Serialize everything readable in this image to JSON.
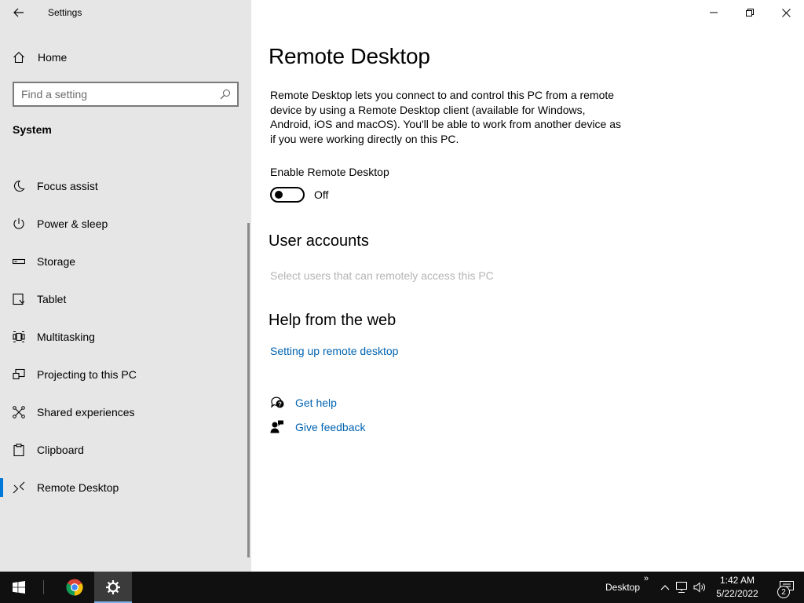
{
  "window": {
    "title": "Settings"
  },
  "sidebar": {
    "home_label": "Home",
    "search_placeholder": "Find a setting",
    "section_title": "System",
    "items": [
      {
        "label": "Focus assist",
        "icon": "moon-icon"
      },
      {
        "label": "Power & sleep",
        "icon": "power-icon"
      },
      {
        "label": "Storage",
        "icon": "storage-icon"
      },
      {
        "label": "Tablet",
        "icon": "tablet-icon"
      },
      {
        "label": "Multitasking",
        "icon": "multitasking-icon"
      },
      {
        "label": "Projecting to this PC",
        "icon": "projecting-icon"
      },
      {
        "label": "Shared experiences",
        "icon": "shared-experiences-icon"
      },
      {
        "label": "Clipboard",
        "icon": "clipboard-icon"
      },
      {
        "label": "Remote Desktop",
        "icon": "remote-desktop-icon",
        "active": true
      }
    ]
  },
  "main": {
    "title": "Remote Desktop",
    "description": "Remote Desktop lets you connect to and control this PC from a remote device by using a Remote Desktop client (available for Windows, Android, iOS and macOS). You'll be able to work from another device as if you were working directly on this PC.",
    "toggle": {
      "label": "Enable Remote Desktop",
      "state": "Off",
      "on": false
    },
    "user_accounts": {
      "heading": "User accounts",
      "link": "Select users that can remotely access this PC"
    },
    "help": {
      "heading": "Help from the web",
      "link": "Setting up remote desktop"
    },
    "get_help": "Get help",
    "give_feedback": "Give feedback"
  },
  "taskbar": {
    "toolbar_label": "Desktop",
    "chevron": "»",
    "time": "1:42 AM",
    "date": "5/22/2022",
    "notification_count": "2"
  },
  "colors": {
    "accent": "#0078d7",
    "link": "#0063b1",
    "sidebar_bg": "#e6e6e6",
    "taskbar_bg": "#101010"
  }
}
